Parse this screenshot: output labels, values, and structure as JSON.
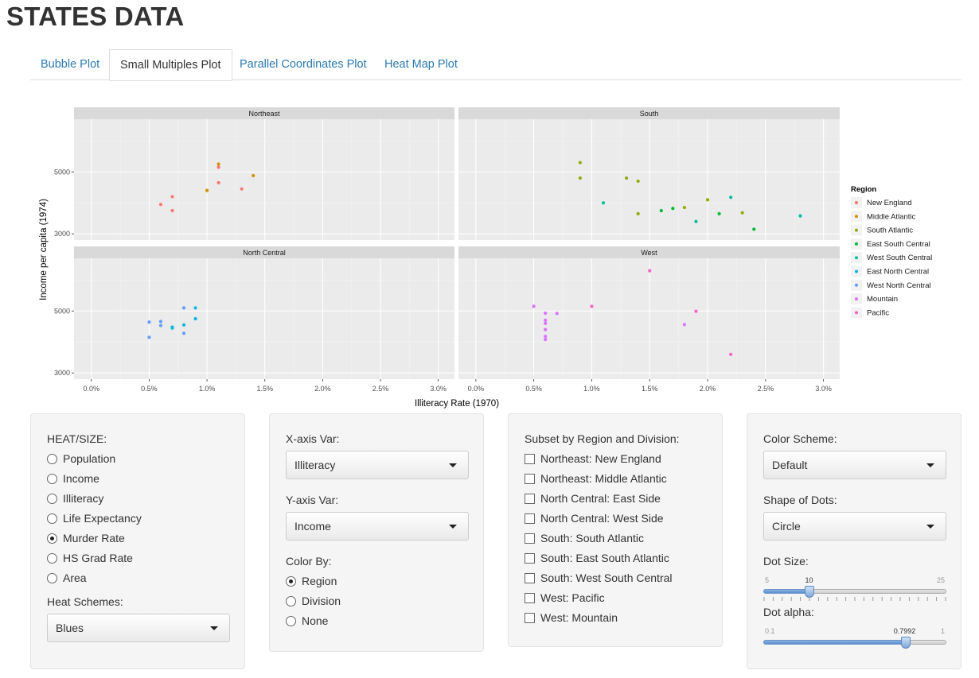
{
  "page": {
    "title": "STATES DATA"
  },
  "tabs": [
    {
      "label": "Bubble Plot",
      "active": false
    },
    {
      "label": "Small Multiples Plot",
      "active": true
    },
    {
      "label": "Parallel Coordinates Plot",
      "active": false
    },
    {
      "label": "Heat Map Plot",
      "active": false
    }
  ],
  "chart_data": {
    "type": "scatter",
    "xlabel": "Illiteracy Rate (1970)",
    "ylabel": "Income per capita (1974)",
    "x_ticks": [
      "0.0%",
      "0.5%",
      "1.0%",
      "1.5%",
      "2.0%",
      "2.5%",
      "3.0%"
    ],
    "y_ticks": [
      "3000",
      "5000"
    ],
    "xlim": [
      -0.0015,
      0.0314
    ],
    "ylim": [
      2800,
      6700
    ],
    "grid": true,
    "legend": {
      "title": "Region",
      "placement": "right"
    },
    "panels": [
      "Northeast",
      "South",
      "North Central",
      "West"
    ],
    "series": [
      {
        "name": "New England",
        "color": "#F8766D",
        "panel": "Northeast",
        "points": [
          [
            0.007,
            4200
          ],
          [
            0.006,
            3950
          ],
          [
            0.007,
            3750
          ],
          [
            0.011,
            4650
          ],
          [
            0.013,
            4450
          ],
          [
            0.011,
            5150
          ]
        ]
      },
      {
        "name": "Middle Atlantic",
        "color": "#D39200",
        "panel": "Northeast",
        "points": [
          [
            0.01,
            4400
          ],
          [
            0.011,
            5250
          ],
          [
            0.014,
            4880
          ]
        ]
      },
      {
        "name": "South Atlantic",
        "color": "#93AA00",
        "panel": "South",
        "points": [
          [
            0.009,
            5300
          ],
          [
            0.009,
            4800
          ],
          [
            0.013,
            4800
          ],
          [
            0.014,
            4700
          ],
          [
            0.014,
            3650
          ],
          [
            0.018,
            3850
          ],
          [
            0.02,
            4100
          ],
          [
            0.023,
            3680
          ]
        ]
      },
      {
        "name": "East South Central",
        "color": "#00BA38",
        "panel": "South",
        "points": [
          [
            0.016,
            3750
          ],
          [
            0.017,
            3820
          ],
          [
            0.021,
            3650
          ],
          [
            0.024,
            3150
          ]
        ]
      },
      {
        "name": "West South Central",
        "color": "#00C19F",
        "panel": "South",
        "points": [
          [
            0.011,
            4000
          ],
          [
            0.019,
            3400
          ],
          [
            0.022,
            4180
          ],
          [
            0.028,
            3580
          ]
        ]
      },
      {
        "name": "East North Central",
        "color": "#00B9E3",
        "panel": "North Central",
        "points": [
          [
            0.007,
            4450
          ],
          [
            0.007,
            4480
          ],
          [
            0.008,
            4550
          ],
          [
            0.009,
            4750
          ],
          [
            0.009,
            5100
          ]
        ]
      },
      {
        "name": "West North Central",
        "color": "#619CFF",
        "panel": "North Central",
        "points": [
          [
            0.005,
            4150
          ],
          [
            0.005,
            4640
          ],
          [
            0.006,
            4530
          ],
          [
            0.006,
            4660
          ],
          [
            0.008,
            4280
          ],
          [
            0.008,
            5100
          ]
        ]
      },
      {
        "name": "Mountain",
        "color": "#DB72FB",
        "panel": "West",
        "points": [
          [
            0.005,
            5150
          ],
          [
            0.006,
            4930
          ],
          [
            0.006,
            4700
          ],
          [
            0.006,
            4600
          ],
          [
            0.006,
            4400
          ],
          [
            0.006,
            4180
          ],
          [
            0.006,
            4080
          ],
          [
            0.007,
            4920
          ],
          [
            0.018,
            4560
          ]
        ]
      },
      {
        "name": "Pacific",
        "color": "#FF61C3",
        "panel": "West",
        "points": [
          [
            0.01,
            5150
          ],
          [
            0.015,
            6300
          ],
          [
            0.019,
            4990
          ],
          [
            0.022,
            3600
          ]
        ]
      }
    ]
  },
  "heat_panel": {
    "label": "HEAT/SIZE:",
    "options": [
      "Population",
      "Income",
      "Illiteracy",
      "Life Expectancy",
      "Murder Rate",
      "HS Grad Rate",
      "Area"
    ],
    "selected": "Murder Rate",
    "schemes_label": "Heat Schemes:",
    "schemes_value": "Blues"
  },
  "axis_panel": {
    "x_label": "X-axis Var:",
    "x_value": "Illiteracy",
    "y_label": "Y-axis Var:",
    "y_value": "Income",
    "color_label": "Color By:",
    "color_options": [
      "Region",
      "Division",
      "None"
    ],
    "color_selected": "Region"
  },
  "subset_panel": {
    "label": "Subset by Region and Division:",
    "options": [
      "Northeast: New England",
      "Northeast: Middle Atlantic",
      "North Central: East Side",
      "North Central: West Side",
      "South: South Atlantic",
      "South: East South Atlantic",
      "South: West South Central",
      "West: Pacific",
      "West: Mountain"
    ]
  },
  "style_panel": {
    "color_label": "Color Scheme:",
    "color_value": "Default",
    "shape_label": "Shape of Dots:",
    "shape_value": "Circle",
    "size_label": "Dot Size:",
    "size_min": "5",
    "size_max": "25",
    "size_value": "10",
    "size_fraction": 0.25,
    "alpha_label": "Dot alpha:",
    "alpha_min": "0.1",
    "alpha_max": "1",
    "alpha_value": "0.7992",
    "alpha_fraction": 0.777
  }
}
